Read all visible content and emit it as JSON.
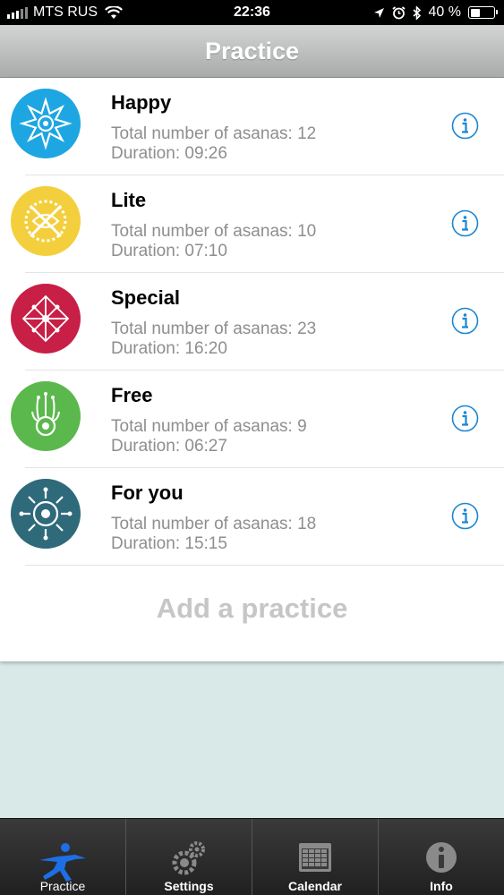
{
  "status_bar": {
    "carrier": "MTS RUS",
    "time": "22:36",
    "battery": "40 %",
    "battery_level": 0.4
  },
  "nav": {
    "title": "Practice"
  },
  "practices": [
    {
      "title": "Happy",
      "asanas": "Total number of asanas: 12",
      "duration": "Duration: 09:26",
      "icon": "star-sun-icon",
      "color": "#1da6e2"
    },
    {
      "title": "Lite",
      "asanas": "Total number of asanas: 10",
      "duration": "Duration: 07:10",
      "icon": "gear-swirl-icon",
      "color": "#f4cf3d"
    },
    {
      "title": "Special",
      "asanas": "Total number of asanas: 23",
      "duration": "Duration: 16:20",
      "icon": "lattice-icon",
      "color": "#c71f46"
    },
    {
      "title": "Free",
      "asanas": "Total number of asanas: 9",
      "duration": "Duration: 06:27",
      "icon": "flower-wheel-icon",
      "color": "#5bb84c"
    },
    {
      "title": "For you",
      "asanas": "Total number of asanas: 18",
      "duration": "Duration: 15:15",
      "icon": "sun-burst-icon",
      "color": "#2e6a7a"
    }
  ],
  "add_practice": "Add a practice",
  "tabs": [
    {
      "label": "Practice",
      "icon": "yoga-pose-icon",
      "active": true
    },
    {
      "label": "Settings",
      "icon": "gears-icon",
      "active": false
    },
    {
      "label": "Calendar",
      "icon": "calendar-icon",
      "active": false
    },
    {
      "label": "Info",
      "icon": "info-icon",
      "active": false
    }
  ],
  "colors": {
    "accent": "#1a87d4",
    "nav_title": "#ffffff",
    "subtitle": "#8e8e8e",
    "background": "#d9e9e8",
    "tab_active": "#1e6ee6"
  }
}
